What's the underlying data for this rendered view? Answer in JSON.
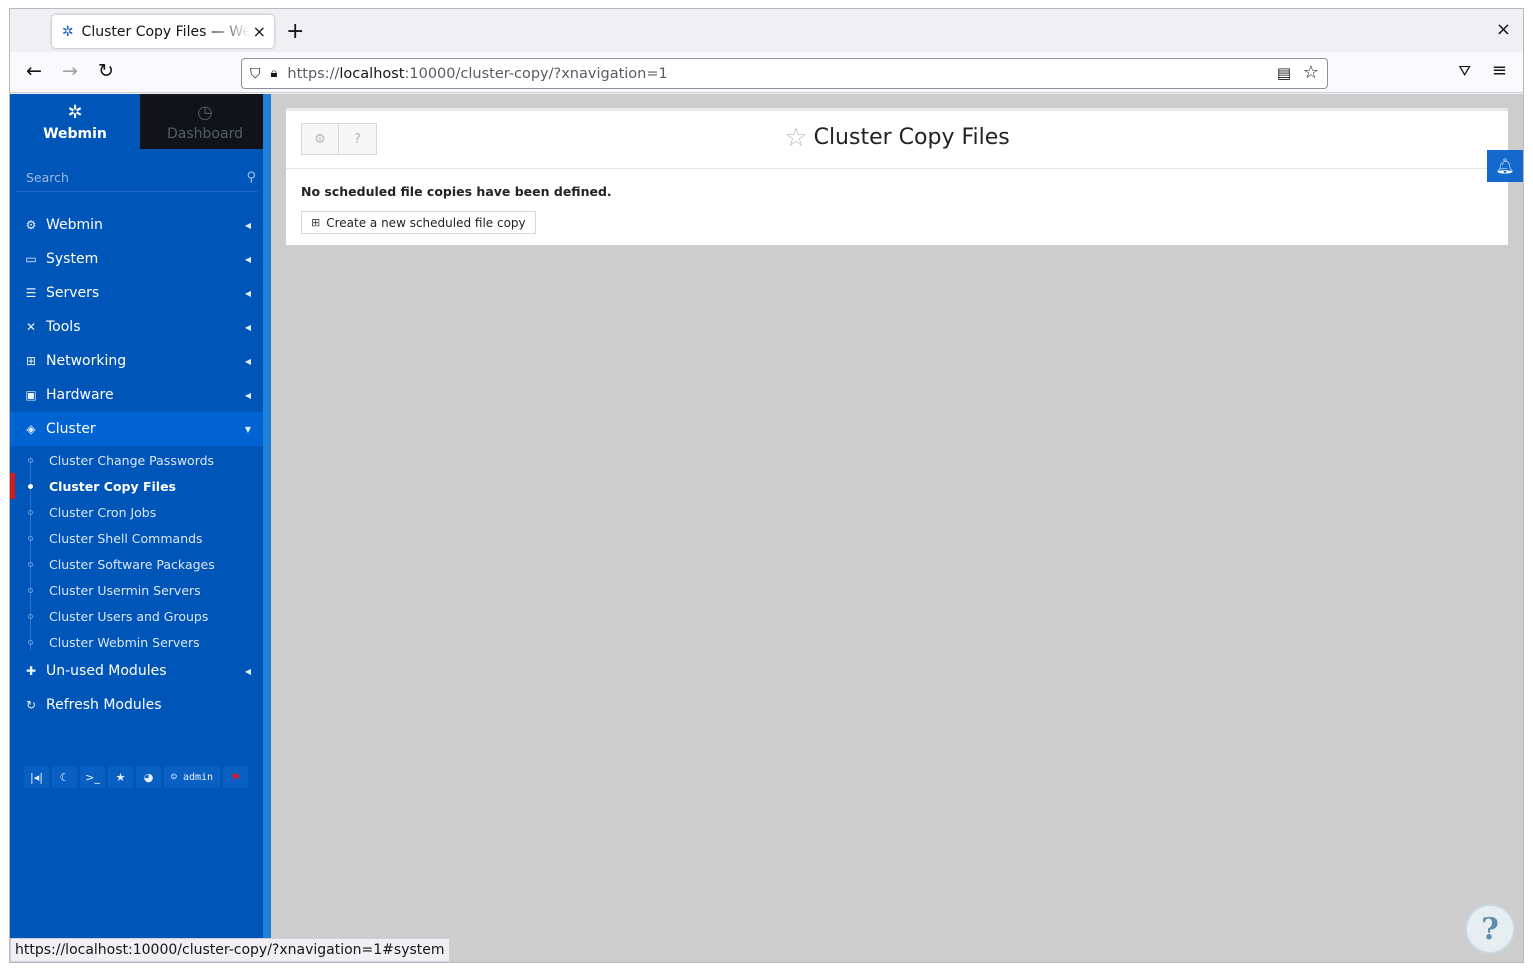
{
  "browser": {
    "tab_title": "Cluster Copy Files — Webmin",
    "tab_close": "×",
    "new_tab": "+",
    "window_close": "×",
    "url_prefix": "https://",
    "url_host": "localhost",
    "url_rest": ":10000/cluster-copy/?xnavigation=1",
    "status_url": "https://localhost:10000/cluster-copy/?xnavigation=1#system"
  },
  "sidebar": {
    "webmin_label": "Webmin",
    "dashboard_label": "Dashboard",
    "search_placeholder": "Search",
    "menu": [
      {
        "label": "Webmin",
        "icon": "gear-icon"
      },
      {
        "label": "System",
        "icon": "laptop-icon"
      },
      {
        "label": "Servers",
        "icon": "server-icon"
      },
      {
        "label": "Tools",
        "icon": "tools-icon"
      },
      {
        "label": "Networking",
        "icon": "network-icon"
      },
      {
        "label": "Hardware",
        "icon": "hdd-icon"
      },
      {
        "label": "Cluster",
        "icon": "layers-icon"
      }
    ],
    "cluster_items": [
      "Cluster Change Passwords",
      "Cluster Copy Files",
      "Cluster Cron Jobs",
      "Cluster Shell Commands",
      "Cluster Software Packages",
      "Cluster Usermin Servers",
      "Cluster Users and Groups",
      "Cluster Webmin Servers"
    ],
    "unused_modules": "Un-used Modules",
    "refresh_modules": "Refresh Modules",
    "admin_label": "admin"
  },
  "main": {
    "title": "Cluster Copy Files",
    "message": "No scheduled file copies have been defined.",
    "create_button": "Create a new scheduled file copy"
  },
  "colors": {
    "sidebar_bg": "#0055b8",
    "active_item_bg": "#0063d2",
    "current_marker": "#d41b1b",
    "main_bg": "#cdcdcd",
    "bell_bg": "#1369cc"
  }
}
